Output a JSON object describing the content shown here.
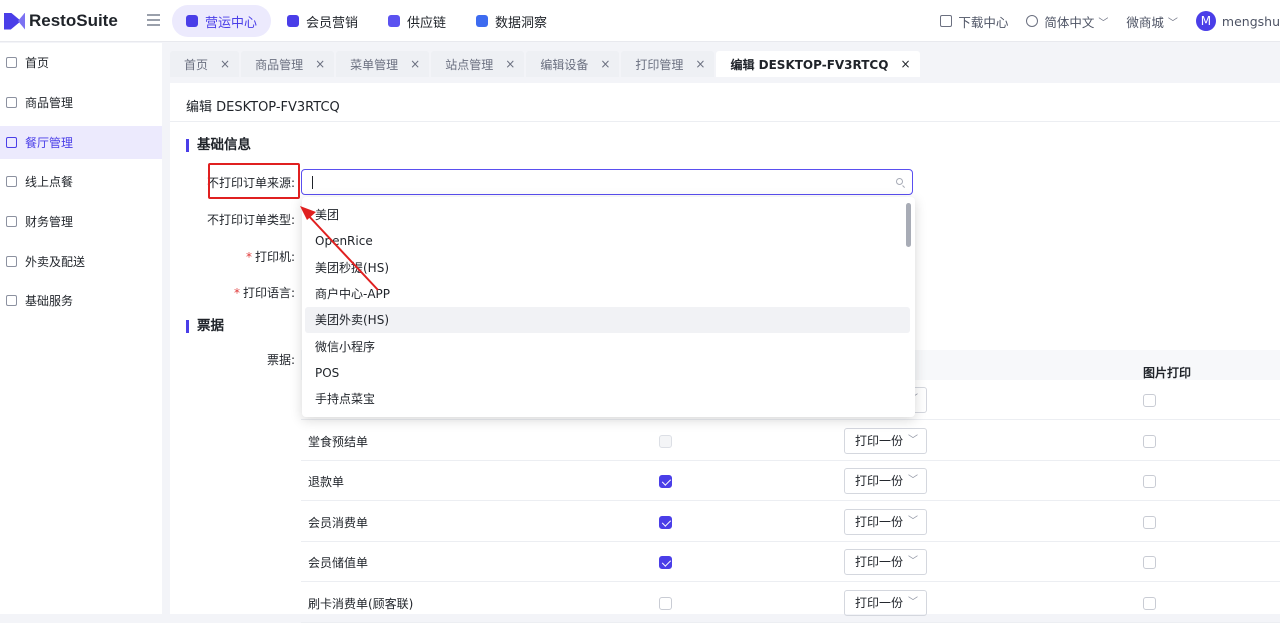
{
  "app": {
    "name": "RestoSuite"
  },
  "topnav": [
    {
      "label": "营运中心",
      "active": true,
      "color": "#4a3ee8"
    },
    {
      "label": "会员营销",
      "active": false,
      "color": "#4a3ee8"
    },
    {
      "label": "供应链",
      "active": false,
      "color": "#5b52f0"
    },
    {
      "label": "数据洞察",
      "active": false,
      "color": "#3d6bf0"
    }
  ],
  "topright": {
    "download": "下载中心",
    "language": "简体中文",
    "mall": "微商城",
    "avatar_letter": "M",
    "user": "mengshu"
  },
  "sidebar": [
    {
      "label": "首页",
      "icon": "home-icon",
      "active": false
    },
    {
      "label": "商品管理",
      "icon": "box-icon",
      "active": false
    },
    {
      "label": "餐厅管理",
      "icon": "store-icon",
      "active": true
    },
    {
      "label": "线上点餐",
      "icon": "order-icon",
      "active": false
    },
    {
      "label": "财务管理",
      "icon": "wallet-icon",
      "active": false
    },
    {
      "label": "外卖及配送",
      "icon": "bag-icon",
      "active": false
    },
    {
      "label": "基础服务",
      "icon": "grid-icon",
      "active": false
    }
  ],
  "tabs": [
    {
      "label": "首页",
      "active": false
    },
    {
      "label": "商品管理",
      "active": false
    },
    {
      "label": "菜单管理",
      "active": false
    },
    {
      "label": "站点管理",
      "active": false
    },
    {
      "label": "编辑设备",
      "active": false
    },
    {
      "label": "打印管理",
      "active": false
    },
    {
      "label": "编辑 DESKTOP-FV3RTCQ",
      "active": true
    }
  ],
  "page": {
    "title": "编辑 DESKTOP-FV3RTCQ",
    "section_basic": "基础信息",
    "section_receipt": "票据",
    "fields": {
      "no_print_source": "不打印订单来源:",
      "no_print_type": "不打印订单类型:",
      "printer": "打印机:",
      "print_lang": "打印语言:",
      "receipt": "票据:"
    },
    "search_value": ""
  },
  "dropdown_options": [
    "美团",
    "OpenRice",
    "美团秒提(HS)",
    "商户中心-APP",
    "美团外卖(HS)",
    "微信小程序",
    "POS",
    "手持点菜宝"
  ],
  "table": {
    "col_image_print": "图片打印",
    "rows": [
      {
        "name": "",
        "checked": false,
        "copies": "打印一份"
      },
      {
        "name": "堂食预结单",
        "checked": false,
        "disabled": true,
        "copies": "打印一份"
      },
      {
        "name": "退款单",
        "checked": true,
        "copies": "打印一份"
      },
      {
        "name": "会员消费单",
        "checked": true,
        "copies": "打印一份"
      },
      {
        "name": "会员储值单",
        "checked": true,
        "copies": "打印一份"
      },
      {
        "name": "刷卡消费单(顾客联)",
        "checked": false,
        "copies": "打印一份"
      }
    ]
  },
  "colors": {
    "accent": "#4a3ee8",
    "annotation": "#e02020"
  }
}
